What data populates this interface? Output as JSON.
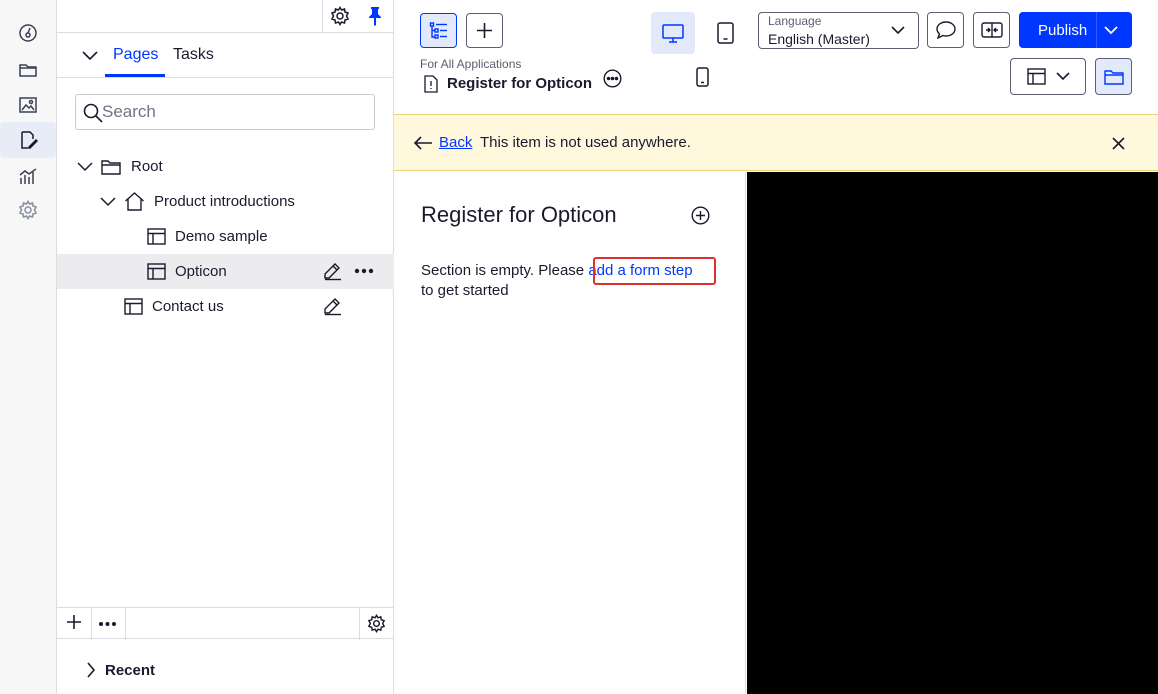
{
  "rail": {
    "items": [
      {
        "icon": "dashboard-icon"
      },
      {
        "icon": "folder-icon"
      },
      {
        "icon": "image-icon"
      },
      {
        "icon": "edit-page-icon",
        "active": true
      },
      {
        "icon": "analytics-icon"
      },
      {
        "icon": "settings-icon"
      }
    ]
  },
  "tree_panel": {
    "tabs": [
      {
        "label": "Pages",
        "active": true
      },
      {
        "label": "Tasks",
        "active": false
      }
    ],
    "search": {
      "placeholder": "Search",
      "value": ""
    },
    "nodes": [
      {
        "label": "Root",
        "icon": "folder-icon",
        "expanded": true
      },
      {
        "label": "Product introductions",
        "icon": "home-icon",
        "expanded": true
      },
      {
        "label": "Demo sample",
        "icon": "layout-icon"
      },
      {
        "label": "Opticon",
        "icon": "layout-icon",
        "selected": true
      },
      {
        "label": "Contact us",
        "icon": "layout-icon"
      }
    ],
    "recent_label": "Recent"
  },
  "toolbar": {
    "language_caption": "Language",
    "language_value": "English (Master)",
    "publish_label": "Publish"
  },
  "breadcrumb": {
    "subtitle": "For All Applications",
    "title": "Register for Opticon"
  },
  "notice": {
    "back_label": "Back",
    "message": "This item is not used anywhere."
  },
  "content": {
    "heading": "Register for Opticon",
    "empty_prefix": "Section is empty. Please ",
    "empty_link": "add a form step",
    "empty_suffix": " to get started"
  },
  "colors": {
    "accent": "#0037ff",
    "notice_bg": "#fff8dd",
    "highlight": "#e03131",
    "preview_bg": "#000000"
  }
}
